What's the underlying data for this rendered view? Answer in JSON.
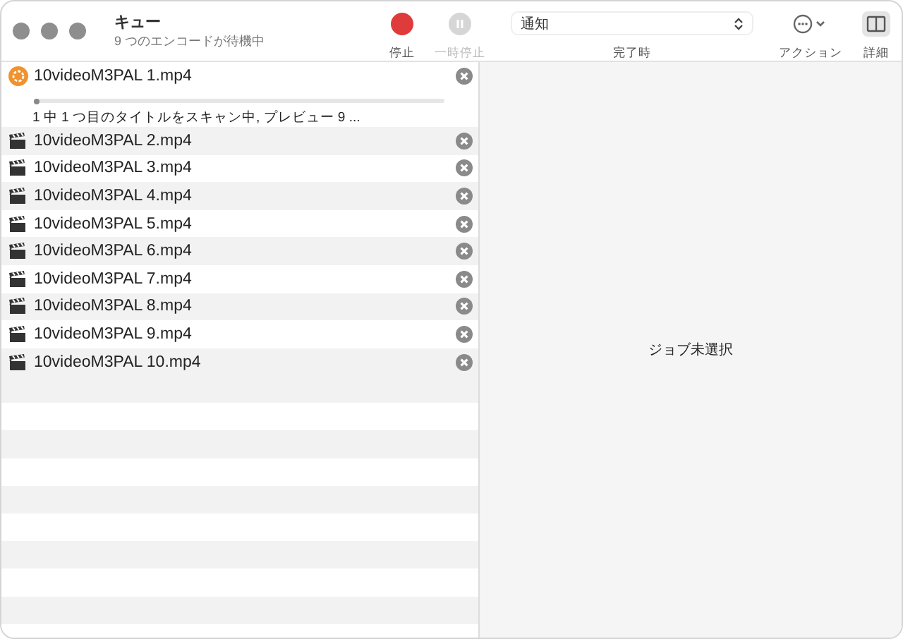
{
  "window": {
    "title": "キュー",
    "subtitle": "9 つのエンコードが待機中"
  },
  "toolbar": [
    {
      "kind": "stop",
      "label": "停止",
      "disabled": false
    },
    {
      "kind": "pause",
      "label": "一時停止",
      "disabled": true
    },
    {
      "kind": "popup",
      "value": "通知",
      "label": "完了時",
      "disabled": false
    },
    {
      "kind": "action",
      "label": "アクション",
      "disabled": false
    },
    {
      "kind": "details",
      "label": "詳細",
      "disabled": false
    }
  ],
  "jobs": [
    {
      "kind": "active",
      "name": "10videoM3PAL 1.mp4",
      "level": 0.01,
      "status": "1 中 1 つ目のタイトルをスキャン中, プレビュー 9 ..."
    },
    {
      "kind": "queued",
      "name": "10videoM3PAL 2.mp4"
    },
    {
      "kind": "queued",
      "name": "10videoM3PAL 3.mp4"
    },
    {
      "kind": "queued",
      "name": "10videoM3PAL 4.mp4"
    },
    {
      "kind": "queued",
      "name": "10videoM3PAL 5.mp4"
    },
    {
      "kind": "queued",
      "name": "10videoM3PAL 6.mp4"
    },
    {
      "kind": "queued",
      "name": "10videoM3PAL 7.mp4"
    },
    {
      "kind": "queued",
      "name": "10videoM3PAL 8.mp4"
    },
    {
      "kind": "queued",
      "name": "10videoM3PAL 9.mp4"
    },
    {
      "kind": "queued",
      "name": "10videoM3PAL 10.mp4"
    }
  ],
  "detail": {
    "empty_message": "ジョブ未選択"
  }
}
